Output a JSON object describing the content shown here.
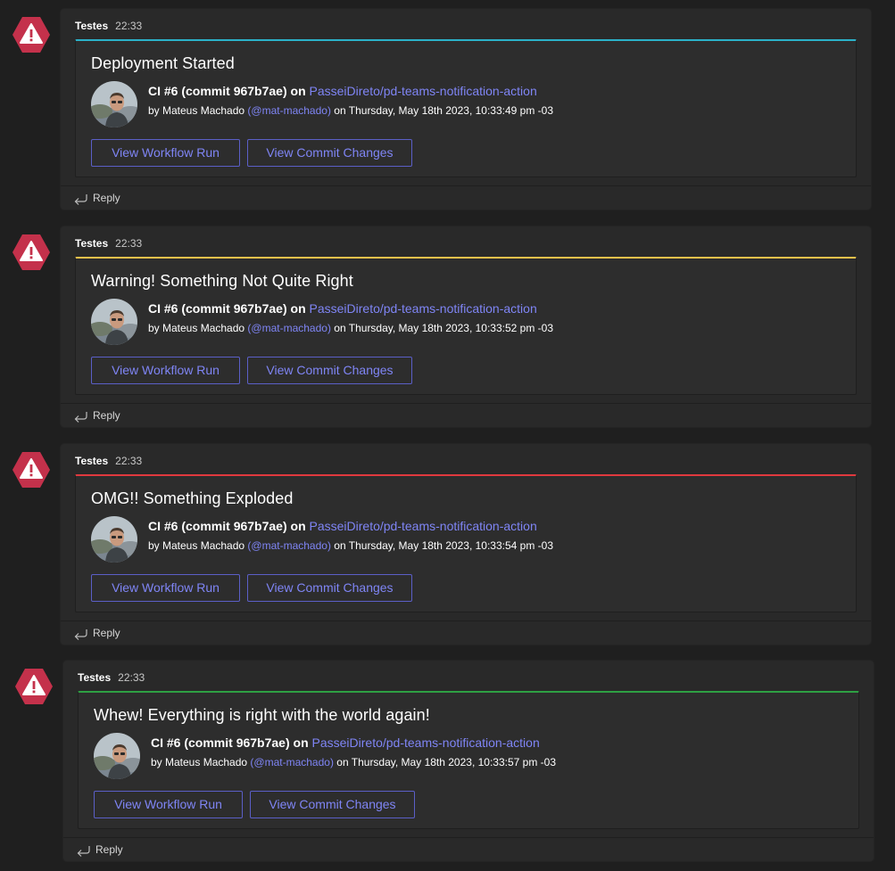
{
  "colors": {
    "accent_started": "#2bb2c9",
    "accent_warning": "#f0c14b",
    "accent_error": "#e0393e",
    "accent_success": "#2ea043",
    "link": "#7f85f5",
    "bot_icon": "#c4314b"
  },
  "icons": {
    "bot": "warning-triangle-icon",
    "reply": "reply-arrow-icon"
  },
  "messages": [
    {
      "sender": "Testes",
      "time": "22:33",
      "card": {
        "title": "Deployment Started",
        "ci_label": "CI #6 (commit 967b7ae)",
        "on_word": "on",
        "repo": "PasseiDireto/pd-teams-notification-action",
        "by_prefix": "by Mateus Machado",
        "handle": "(@mat-machado)",
        "date_text": "on Thursday, May 18th 2023, 10:33:49 pm -03",
        "buttons": [
          "View Workflow Run",
          "View Commit Changes"
        ]
      },
      "reply_label": "Reply"
    },
    {
      "sender": "Testes",
      "time": "22:33",
      "card": {
        "title": "Warning! Something Not Quite Right",
        "ci_label": "CI #6 (commit 967b7ae)",
        "on_word": "on",
        "repo": "PasseiDireto/pd-teams-notification-action",
        "by_prefix": "by Mateus Machado",
        "handle": "(@mat-machado)",
        "date_text": "on Thursday, May 18th 2023, 10:33:52 pm -03",
        "buttons": [
          "View Workflow Run",
          "View Commit Changes"
        ]
      },
      "reply_label": "Reply"
    },
    {
      "sender": "Testes",
      "time": "22:33",
      "card": {
        "title": "OMG!! Something Exploded",
        "ci_label": "CI #6 (commit 967b7ae)",
        "on_word": "on",
        "repo": "PasseiDireto/pd-teams-notification-action",
        "by_prefix": "by Mateus Machado",
        "handle": "(@mat-machado)",
        "date_text": "on Thursday, May 18th 2023, 10:33:54 pm -03",
        "buttons": [
          "View Workflow Run",
          "View Commit Changes"
        ]
      },
      "reply_label": "Reply"
    },
    {
      "sender": "Testes",
      "time": "22:33",
      "card": {
        "title": "Whew! Everything is right with the world again!",
        "ci_label": "CI #6 (commit 967b7ae)",
        "on_word": "on",
        "repo": "PasseiDireto/pd-teams-notification-action",
        "by_prefix": "by Mateus Machado",
        "handle": "(@mat-machado)",
        "date_text": "on Thursday, May 18th 2023, 10:33:57 pm -03",
        "buttons": [
          "View Workflow Run",
          "View Commit Changes"
        ]
      },
      "reply_label": "Reply"
    }
  ]
}
